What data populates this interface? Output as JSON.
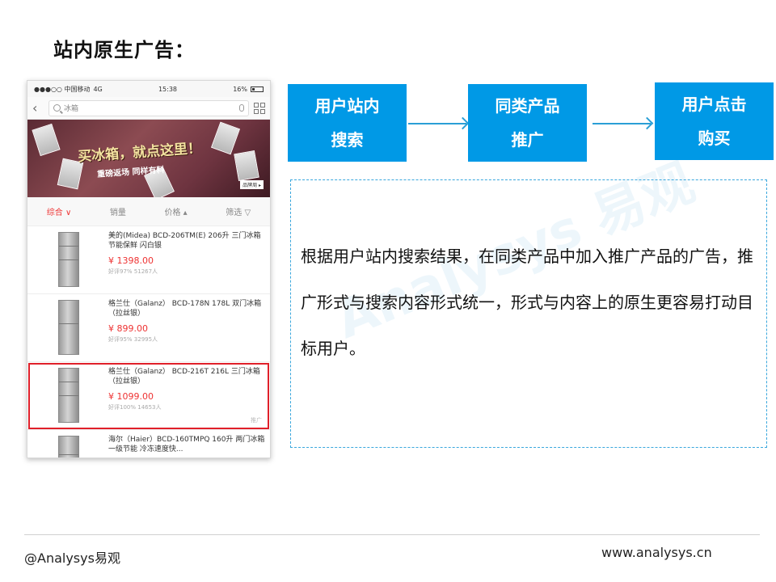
{
  "slide": {
    "title": "站内原生广告："
  },
  "phone": {
    "status": {
      "carrier": "●●●○○ 中国移动",
      "network": "4G",
      "time": "15:38",
      "battery": "16%"
    },
    "search": {
      "query": "冰箱"
    },
    "banner": {
      "headline": "买冰箱，就点这里！",
      "subline": "重磅返场  同样有料",
      "tag": "品牌周 ▸"
    },
    "filters": [
      {
        "label": "综合 ∨",
        "active": true
      },
      {
        "label": "销量",
        "active": false
      },
      {
        "label": "价格 ▴",
        "active": false
      },
      {
        "label": "筛选 ▽",
        "active": false
      }
    ],
    "products": [
      {
        "name": "美的(Midea) BCD-206TM(E) 206升 三门冰箱 节能保鲜 闪白银",
        "price": "¥ 1398.00",
        "meta": "好评97%  51267人",
        "promo_tag": ""
      },
      {
        "name": "格兰仕（Galanz） BCD-178N 178L 双门冰箱（拉丝银）",
        "price": "¥ 899.00",
        "meta": "好评95%  32995人",
        "promo_tag": ""
      },
      {
        "name": "格兰仕（Galanz） BCD-216T 216L 三门冰箱（拉丝银）",
        "price": "¥ 1099.00",
        "meta": "好评100%  14653人",
        "promo_tag": "推广"
      },
      {
        "name": "海尔（Haier）BCD-160TMPQ 160升 两门冰箱 一级节能 冷冻速度快...",
        "price": "",
        "meta": "",
        "promo_tag": ""
      }
    ]
  },
  "flow": {
    "steps": [
      {
        "line1": "用户站内",
        "line2": "搜索"
      },
      {
        "line1": "同类产品",
        "line2": "推广"
      },
      {
        "line1": "用户点击",
        "line2": "购买"
      }
    ],
    "color": "#0099e6"
  },
  "description": {
    "text": "根据用户站内搜索结果，在同类产品中加入推广产品的广告，推广形式与搜索内容形式统一，形式与内容上的原生更容易打动目标用户。"
  },
  "watermark": "Analysys 易观",
  "footer": {
    "left": "@Analysys易观",
    "right": "www.analysys.cn"
  }
}
